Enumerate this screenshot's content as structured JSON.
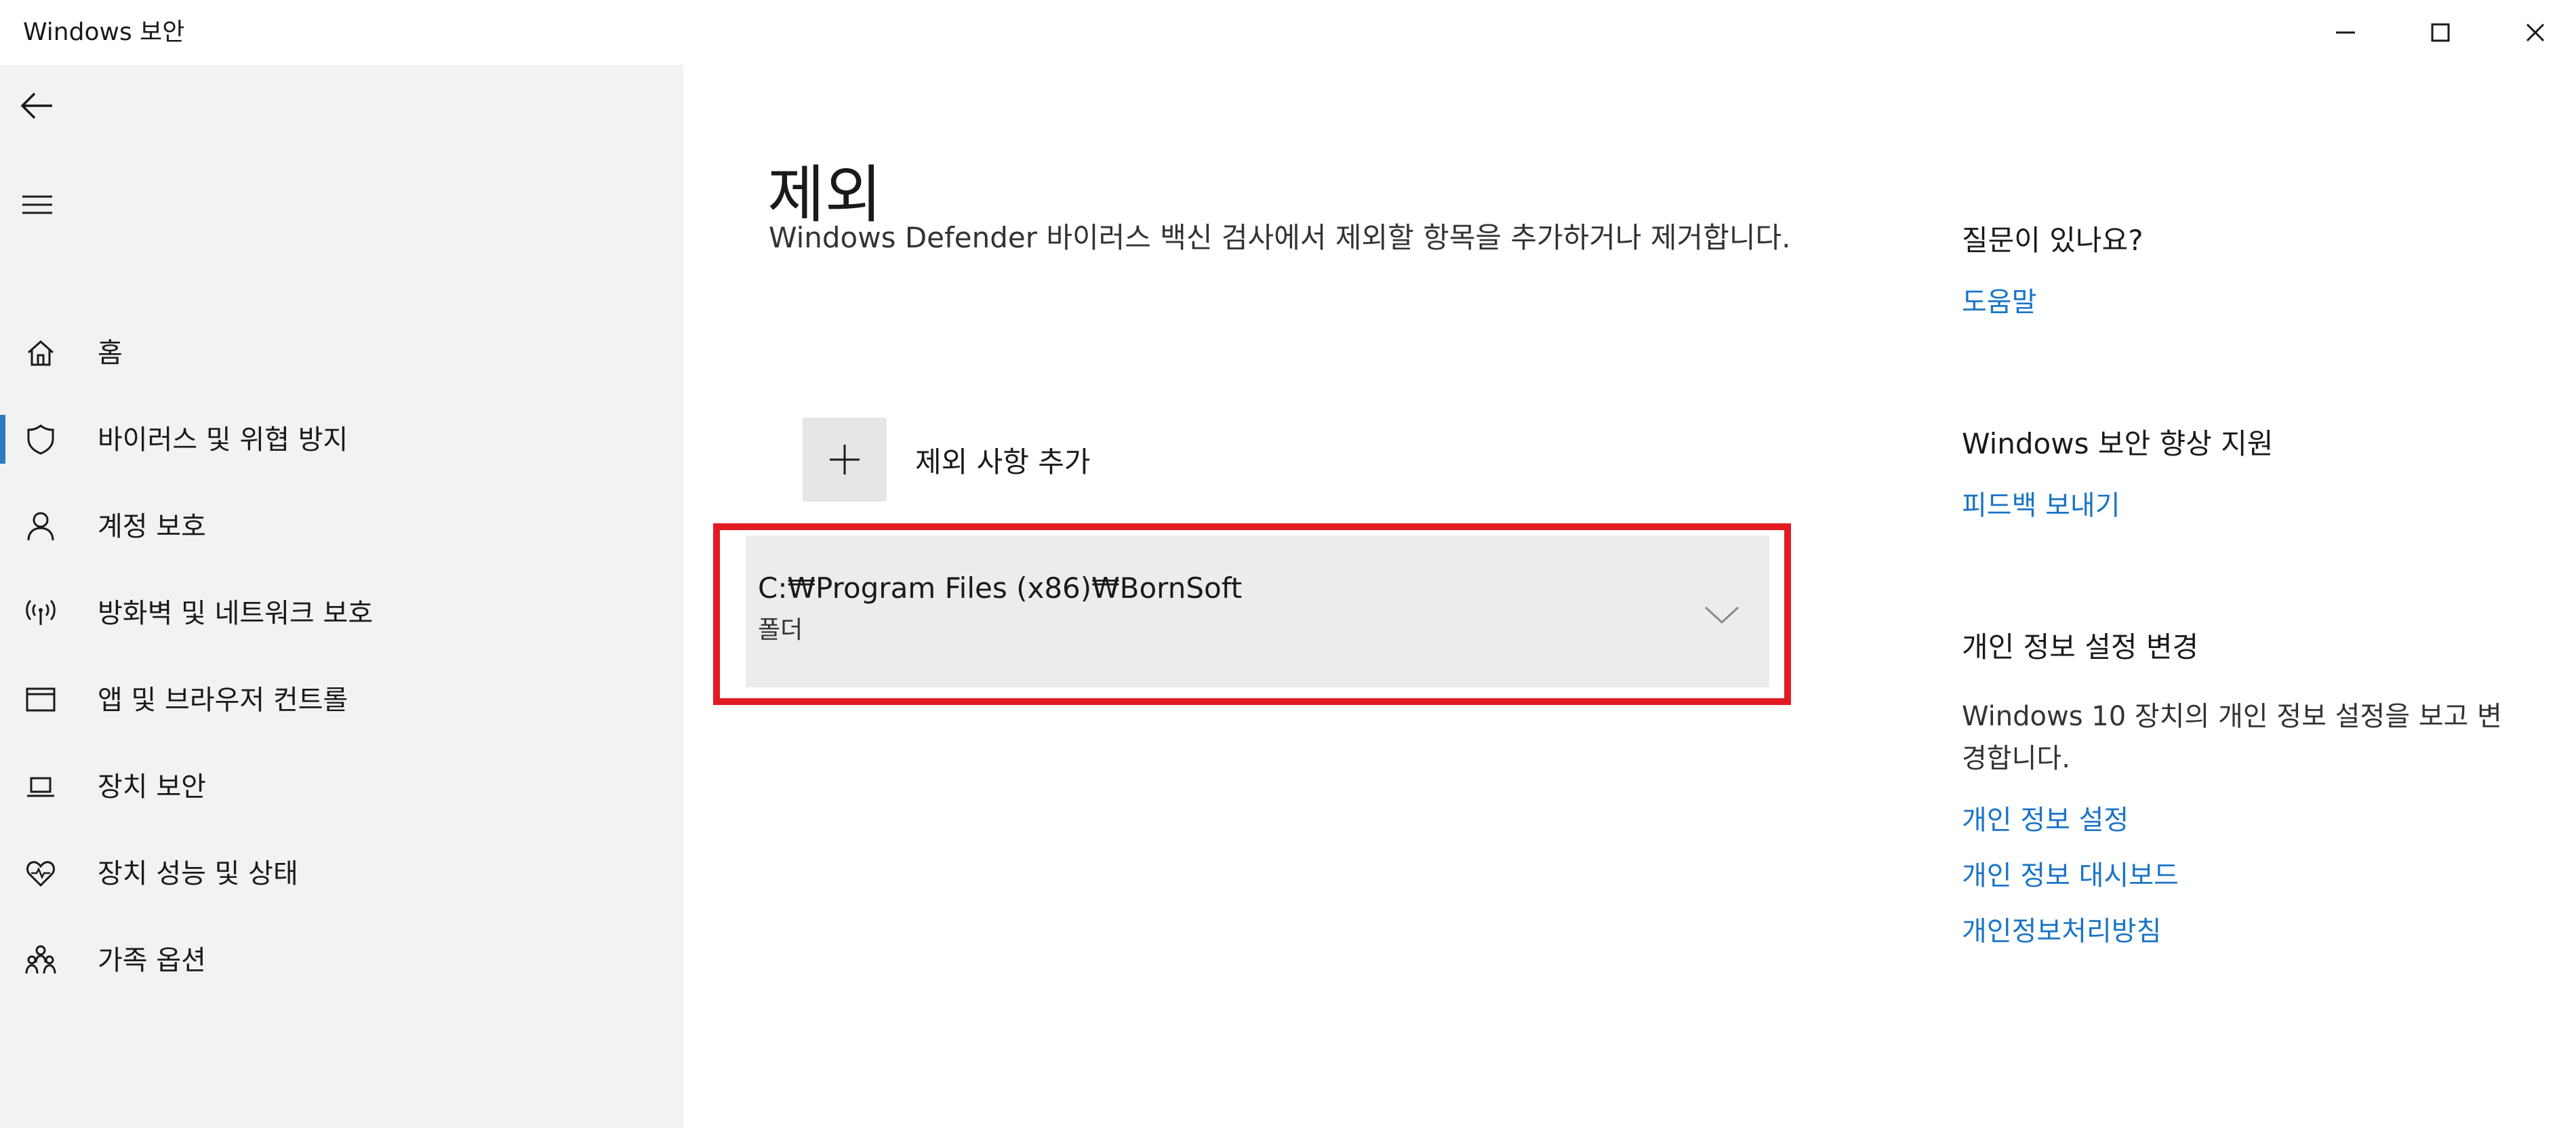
{
  "window": {
    "title": "Windows 보안"
  },
  "sidebar": {
    "items": [
      {
        "label": "홈",
        "icon": "home-icon"
      },
      {
        "label": "바이러스 및 위협 방지",
        "icon": "shield-icon",
        "active": true
      },
      {
        "label": "계정 보호",
        "icon": "person-icon"
      },
      {
        "label": "방화벽 및 네트워크 보호",
        "icon": "wireless-icon"
      },
      {
        "label": "앱 및 브라우저 컨트롤",
        "icon": "browser-window-icon"
      },
      {
        "label": "장치 보안",
        "icon": "laptop-icon"
      },
      {
        "label": "장치 성능 및 상태",
        "icon": "heart-pulse-icon"
      },
      {
        "label": "가족 옵션",
        "icon": "family-icon"
      }
    ],
    "accent_color": "#2b7bc0"
  },
  "main": {
    "title": "제외",
    "description": "Windows Defender 바이러스 백신 검사에서 제외할 항목을 추가하거나 제거합니다.",
    "add_label": "제외 사항 추가",
    "exclusions": [
      {
        "path": "C:₩Program Files (x86)₩BornSoft",
        "type": "폴더"
      }
    ],
    "highlight_color": "#e21b23"
  },
  "right_pane": {
    "question_heading": "질문이 있나요?",
    "help_link": "도움말",
    "improve_heading": "Windows 보안 향상 지원",
    "feedback_link": "피드백 보내기",
    "privacy_heading": "개인 정보 설정 변경",
    "privacy_text": "Windows 10 장치의 개인 정보 설정을 보고 변경합니다.",
    "privacy_settings_link": "개인 정보 설정",
    "privacy_dashboard_link": "개인 정보 대시보드",
    "privacy_policy_link": "개인정보처리방침",
    "link_color": "#1a74c7"
  }
}
